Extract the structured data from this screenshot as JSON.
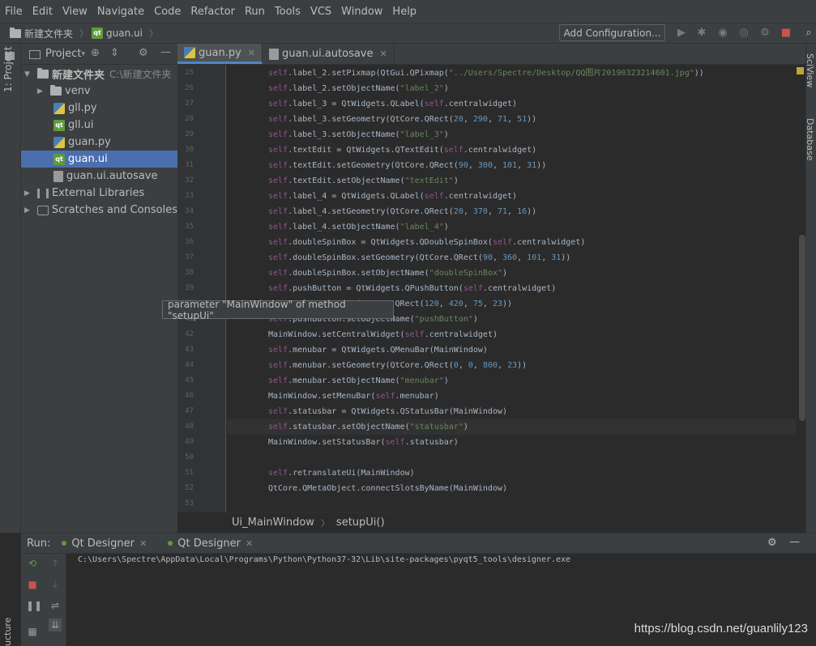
{
  "menu": [
    "File",
    "Edit",
    "View",
    "Navigate",
    "Code",
    "Refactor",
    "Run",
    "Tools",
    "VCS",
    "Window",
    "Help"
  ],
  "nav": {
    "project": "新建文件夹",
    "file": "guan.ui"
  },
  "toolbar": {
    "add_config": "Add Configuration..."
  },
  "left_strip": {
    "project_tab": "1: Project",
    "structure_tab": "ucture"
  },
  "project_panel": {
    "title": "Project",
    "tree": [
      {
        "label": "新建文件夹",
        "path": "C:\\新建文件夹",
        "kind": "folder",
        "expanded": true
      },
      {
        "label": "venv",
        "kind": "folder"
      },
      {
        "label": "gll.py",
        "kind": "py"
      },
      {
        "label": "gll.ui",
        "kind": "qt"
      },
      {
        "label": "guan.py",
        "kind": "py"
      },
      {
        "label": "guan.ui",
        "kind": "qt",
        "selected": true
      },
      {
        "label": "guan.ui.autosave",
        "kind": "file"
      },
      {
        "label": "External Libraries",
        "kind": "lib"
      },
      {
        "label": "Scratches and Consoles",
        "kind": "scratch"
      }
    ]
  },
  "editor_tabs": [
    {
      "label": "guan.py",
      "active": true
    },
    {
      "label": "guan.ui.autosave",
      "active": false
    }
  ],
  "line_numbers": [
    "25",
    "26",
    "27",
    "28",
    "29",
    "30",
    "31",
    "32",
    "33",
    "34",
    "35",
    "36",
    "37",
    "38",
    "39",
    "40",
    "41",
    "42",
    "43",
    "44",
    "45",
    "46",
    "47",
    "48",
    "49",
    "50",
    "51",
    "52",
    "53"
  ],
  "code_lines": [
    "self.label_2.setPixmap(QtGui.QPixmap(\"../Users/Spectre/Desktop/QQ图片20190323214601.jpg\"))",
    "self.label_2.setObjectName(\"label_2\")",
    "self.label_3 = QtWidgets.QLabel(self.centralwidget)",
    "self.label_3.setGeometry(QtCore.QRect(20, 290, 71, 51))",
    "self.label_3.setObjectName(\"label_3\")",
    "self.textEdit = QtWidgets.QTextEdit(self.centralwidget)",
    "self.textEdit.setGeometry(QtCore.QRect(90, 300, 101, 31))",
    "self.textEdit.setObjectName(\"textEdit\")",
    "self.label_4 = QtWidgets.QLabel(self.centralwidget)",
    "self.label_4.setGeometry(QtCore.QRect(20, 370, 71, 16))",
    "self.label_4.setObjectName(\"label_4\")",
    "self.doubleSpinBox = QtWidgets.QDoubleSpinBox(self.centralwidget)",
    "self.doubleSpinBox.setGeometry(QtCore.QRect(90, 360, 101, 31))",
    "self.doubleSpinBox.setObjectName(\"doubleSpinBox\")",
    "self.pushButton = QtWidgets.QPushButton(self.centralwidget)",
    "                 y(QtCore.QRect(120, 420, 75, 23))",
    "self.pushButton.setObjectName(\"pushButton\")",
    "MainWindow.setCentralWidget(self.centralwidget)",
    "self.menubar = QtWidgets.QMenuBar(MainWindow)",
    "self.menubar.setGeometry(QtCore.QRect(0, 0, 800, 23))",
    "self.menubar.setObjectName(\"menubar\")",
    "MainWindow.setMenuBar(self.menubar)",
    "self.statusbar = QtWidgets.QStatusBar(MainWindow)",
    "self.statusbar.setObjectName(\"statusbar\")",
    "MainWindow.setStatusBar(self.statusbar)",
    "",
    "self.retranslateUi(MainWindow)",
    "QtCore.QMetaObject.connectSlotsByName(MainWindow)",
    ""
  ],
  "tooltip": "parameter \"MainWindow\" of method \"setupUi\"",
  "code_breadcrumb": {
    "class": "Ui_MainWindow",
    "method": "setupUi()"
  },
  "right_strip": {
    "scview": "SciView",
    "database": "Database"
  },
  "run_panel": {
    "label": "Run:",
    "tabs": [
      "Qt Designer",
      "Qt Designer"
    ],
    "output": "C:\\Users\\Spectre\\AppData\\Local\\Programs\\Python\\Python37-32\\Lib\\site-packages\\pyqt5_tools\\designer.exe"
  },
  "watermark": "https://blog.csdn.net/guanlily123",
  "colors": {
    "selection": "#4b6eaf",
    "accent": "#4a88c7",
    "self_kw": "#94558d",
    "string": "#6a8759",
    "number": "#6897bb"
  }
}
